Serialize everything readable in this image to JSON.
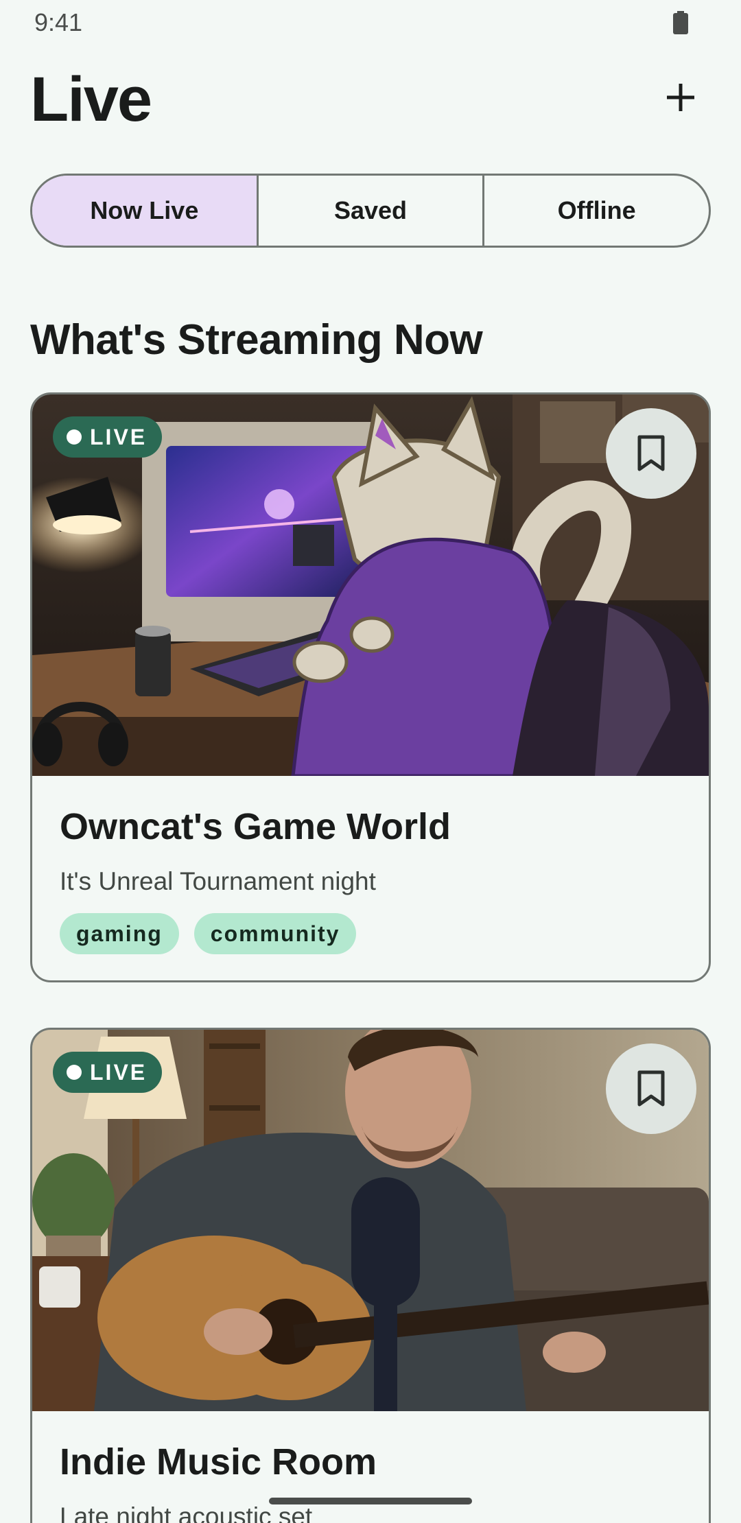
{
  "status_bar": {
    "time": "9:41",
    "battery_icon": "battery-full-icon"
  },
  "header": {
    "title": "Live",
    "add_icon": "plus-icon"
  },
  "tabs": [
    {
      "label": "Now Live",
      "active": true
    },
    {
      "label": "Saved",
      "active": false
    },
    {
      "label": "Offline",
      "active": false
    }
  ],
  "section": {
    "title": "What's Streaming Now"
  },
  "streams": [
    {
      "badge": "LIVE",
      "title": "Owncat's Game World",
      "subtitle": "It's Unreal Tournament night",
      "tags": [
        "gaming",
        "community"
      ],
      "bookmark_icon": "bookmark-outline-icon"
    },
    {
      "badge": "LIVE",
      "title": "Indie Music Room",
      "subtitle": "Late night acoustic set",
      "bookmark_icon": "bookmark-outline-icon"
    }
  ],
  "colors": {
    "background": "#f3f8f5",
    "active_tab": "#e8dbf6",
    "live_badge": "#2b6a54",
    "tag": "#b3e8cf",
    "bookmark_bg": "#dfe5e1"
  }
}
